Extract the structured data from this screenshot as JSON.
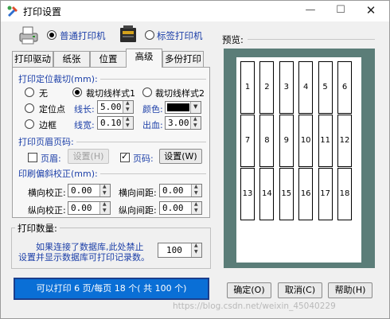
{
  "window": {
    "title": "打印设置",
    "min": "—",
    "max": "☐",
    "close": "✕"
  },
  "printer_types": {
    "normal": "普通打印机",
    "label": "标签打印机",
    "selected": "normal"
  },
  "tabs": [
    {
      "label": "打印驱动",
      "active": false
    },
    {
      "label": "纸张",
      "active": false
    },
    {
      "label": "位置",
      "active": false
    },
    {
      "label": "高级",
      "active": true
    },
    {
      "label": "多份打印",
      "active": false
    }
  ],
  "cut": {
    "title": "打印定位裁切(mm):",
    "none": "无",
    "style1": "裁切线样式1",
    "style2": "裁切线样式2",
    "point": "定位点",
    "frame": "边框",
    "line_length_label": "线长:",
    "line_length": "5.00",
    "color_label": "颜色:",
    "color_value": "#000000",
    "line_width_label": "线宽:",
    "line_width": "0.10",
    "bleed_label": "出血:",
    "bleed": "3.00"
  },
  "header_footer": {
    "title": "打印页眉页码:",
    "header_label": "页眉:",
    "header_checked": false,
    "header_setting": "设置(H)",
    "pagenum_label": "页码:",
    "pagenum_checked": true,
    "pagenum_setting": "设置(W)"
  },
  "skew": {
    "title": "印刷偏斜校正(mm):",
    "h_correct_label": "横向校正:",
    "h_correct": "0.00",
    "h_gap_label": "横向间距:",
    "h_gap": "0.00",
    "v_correct_label": "纵向校正:",
    "v_correct": "0.00",
    "v_gap_label": "纵向间距:",
    "v_gap": "0.00"
  },
  "print_count": {
    "title": "打印数量:",
    "note_line1": "如果连接了数据库,此处禁止",
    "note_line2": "设置并显示数据库可打印记录数。",
    "value": "100"
  },
  "status": "可以打印 6 页/每页 18 个( 共 100 个)",
  "preview": {
    "label": "预览:",
    "cells": [
      "1",
      "2",
      "3",
      "4",
      "5",
      "6",
      "7",
      "8",
      "9",
      "10",
      "11",
      "12",
      "13",
      "14",
      "15",
      "16",
      "17",
      "18"
    ]
  },
  "buttons": {
    "ok": "确定(O)",
    "cancel": "取消(C)",
    "help": "帮助(H)"
  },
  "watermark": "https://blog.csdn.net/weixin_45040229",
  "colors": {
    "status_bg": "#0a6fd6",
    "preview_bg": "#5b7d78",
    "accent_text": "#1c3fa8"
  },
  "icons": [
    "app-settings-icon",
    "inkjet-printer-icon",
    "label-printer-icon"
  ]
}
